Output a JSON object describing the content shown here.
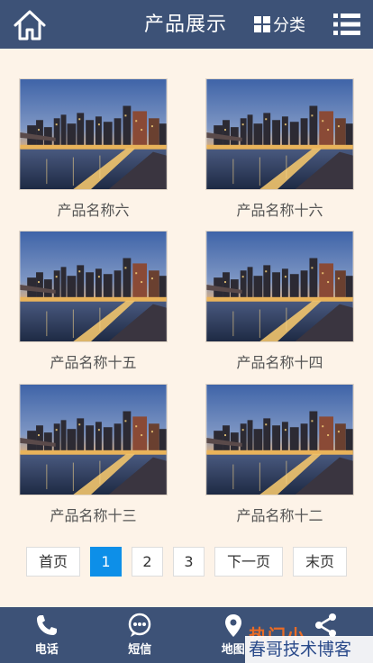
{
  "header": {
    "title": "产品展示",
    "category_label": "分类"
  },
  "products": [
    {
      "name": "产品名称六"
    },
    {
      "name": "产品名称十六"
    },
    {
      "name": "产品名称十五"
    },
    {
      "name": "产品名称十四"
    },
    {
      "name": "产品名称十三"
    },
    {
      "name": "产品名称十二"
    }
  ],
  "pagination": {
    "first": "首页",
    "pages": [
      "1",
      "2",
      "3"
    ],
    "current": "1",
    "next": "下一页",
    "last": "末页"
  },
  "footer": {
    "items": [
      {
        "label": "电话",
        "icon": "phone-icon"
      },
      {
        "label": "短信",
        "icon": "sms-icon"
      },
      {
        "label": "地图",
        "icon": "map-pin-icon"
      },
      {
        "label": "",
        "icon": "share-icon"
      }
    ]
  },
  "watermark": {
    "text": "春哥技术博客",
    "logo_text": "热门小"
  },
  "colors": {
    "header_bg": "#3d5277",
    "page_bg": "#fdf3e8",
    "accent": "#0d8fe8"
  }
}
